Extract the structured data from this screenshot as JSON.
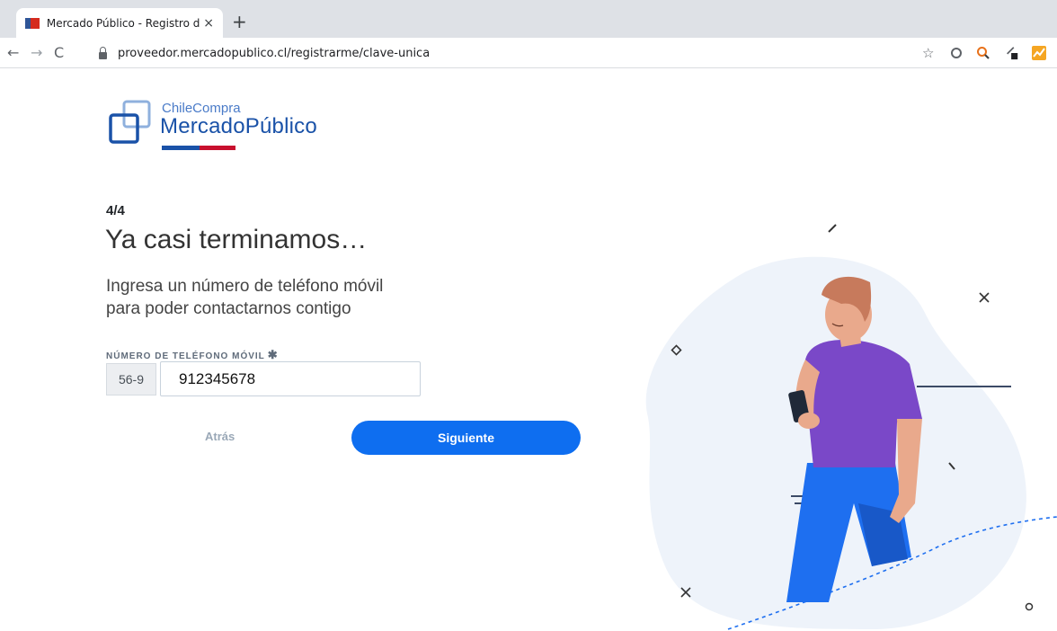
{
  "browser": {
    "tab_title": "Mercado Público - Registro de pr",
    "tab_close": "×",
    "new_tab": "+",
    "url": "proveedor.mercadopublico.cl/registrarme/clave-unica",
    "back": "←",
    "forward": "→",
    "reload": "C",
    "bookmark": "☆"
  },
  "logo": {
    "small_text": "ChileCompra",
    "big_text": "MercadoPúblico"
  },
  "form": {
    "step": "4/4",
    "headline": "Ya casi terminamos…",
    "subtitle_line1": "Ingresa un número de teléfono móvil",
    "subtitle_line2": "para poder contactarnos contigo",
    "phone_label": "NÚMERO DE TELÉFONO MÓVIL",
    "required_mark": "✱",
    "prefix": "56-9",
    "phone_value": "912345678",
    "back_label": "Atrás",
    "next_label": "Siguiente"
  },
  "colors": {
    "primary": "#0e6ef0",
    "brand_blue": "#1a52a8",
    "brand_red": "#c8102e",
    "blob": "#eef3fa",
    "shirt": "#7a48c8",
    "pants": "#1e6ff0",
    "skin": "#e9a98c",
    "hair": "#c77a5c"
  },
  "icons": {
    "lock": "lock-icon",
    "extensions": [
      "circle-icon",
      "search-extension-icon",
      "pen-extension-icon",
      "chart-extension-icon"
    ]
  }
}
